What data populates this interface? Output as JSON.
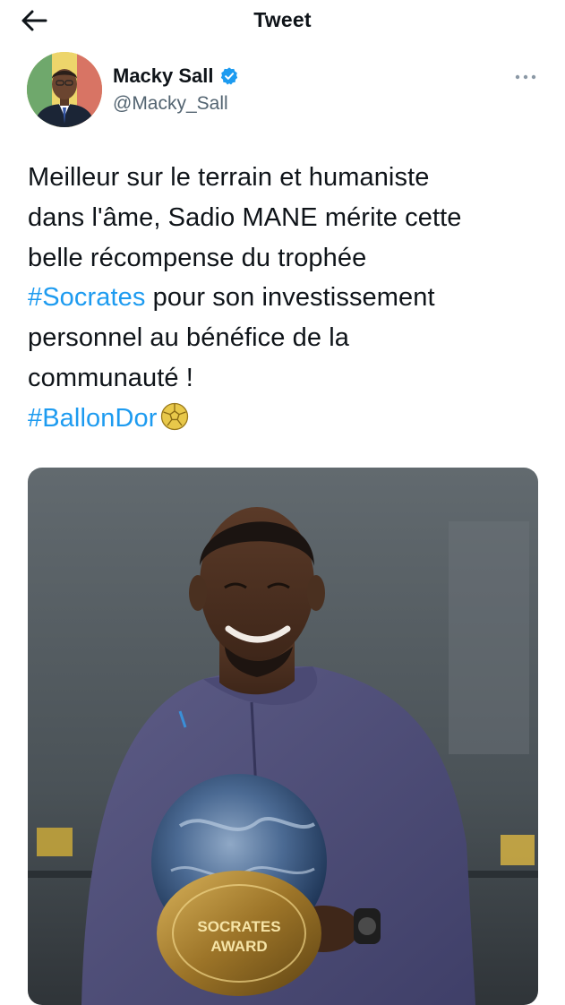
{
  "header": {
    "title": "Tweet",
    "back_icon": "arrow-left-icon"
  },
  "author": {
    "name": "Macky Sall",
    "handle": "@Macky_Sall",
    "verified_color": "#1d9bf0",
    "more_icon": "more-horizontal-icon"
  },
  "tweet": {
    "lines": [
      "Meilleur sur le terrain et humaniste",
      "dans l'âme, Sadio MANE mérite cette",
      "belle récompense du trophée"
    ],
    "hashtag1": "#Socrates",
    "line4_rest": " pour son investissement",
    "line5": "personnel au bénéfice de la",
    "line6": "communauté !",
    "hashtag2": "#BallonDor",
    "emoji": "soccer-ball-icon"
  },
  "media": {
    "trophy_lines": [
      "SOCRATES",
      "AWARD"
    ]
  },
  "colors": {
    "link": "#1d9bf0",
    "text": "#0f1419",
    "muted": "#536471"
  }
}
